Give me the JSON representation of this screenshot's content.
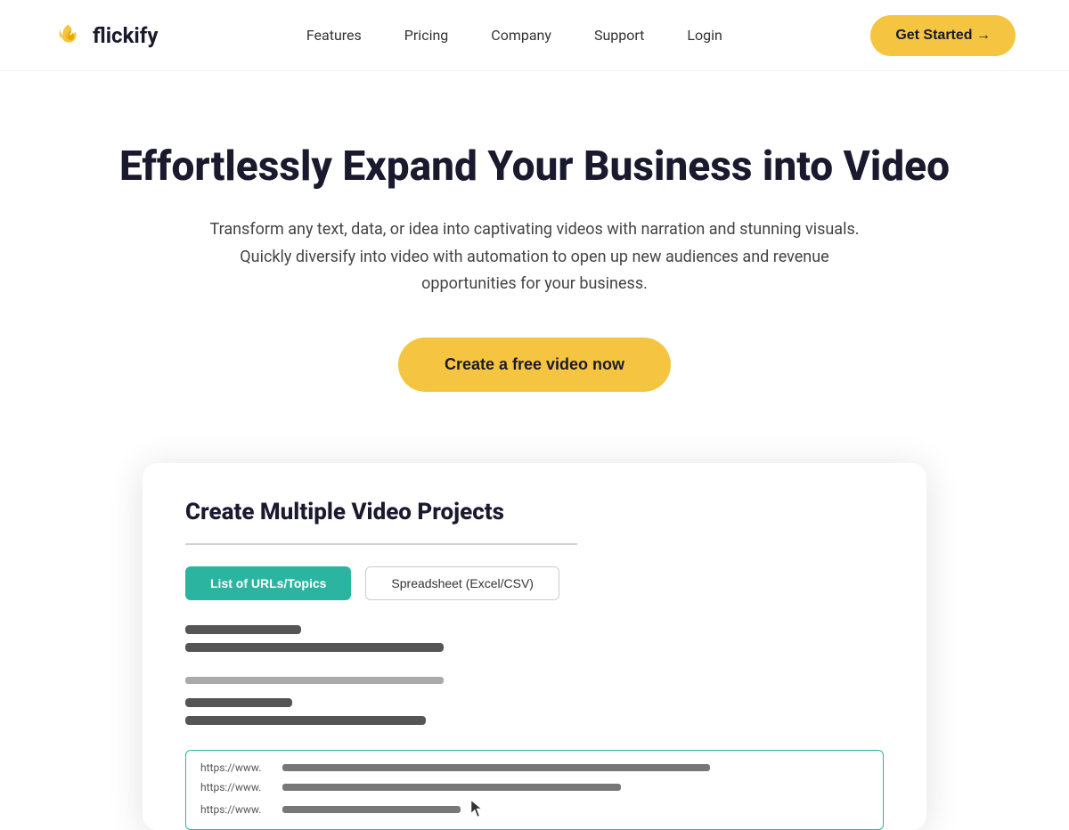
{
  "navbar": {
    "logo_text": "flickify",
    "nav_items": [
      {
        "label": "Features",
        "href": "#"
      },
      {
        "label": "Pricing",
        "href": "#"
      },
      {
        "label": "Company",
        "href": "#"
      },
      {
        "label": "Support",
        "href": "#"
      },
      {
        "label": "Login",
        "href": "#"
      }
    ],
    "cta_button": "Get Started →"
  },
  "hero": {
    "title": "Effortlessly Expand Your Business into Video",
    "subtitle": "Transform any text, data, or idea into captivating videos with narration and stunning visuals.  Quickly diversify into video with automation to open up new audiences and revenue opportunities for your business.",
    "cta_button": "Create a free video now"
  },
  "demo": {
    "title": "Create Multiple Video Projects",
    "tab_active": "List of URLs/Topics",
    "tab_inactive": "Spreadsheet (Excel/CSV)",
    "url_rows": [
      {
        "label": "https://www.",
        "bar_class": "demo-url-bar-long"
      },
      {
        "label": "https://www.",
        "bar_class": "demo-url-bar-medium"
      },
      {
        "label": "https://www.",
        "bar_class": "demo-url-bar-short"
      }
    ]
  },
  "colors": {
    "accent_yellow": "#f5c542",
    "accent_teal": "#2bb5a0",
    "text_dark": "#1a1a2e"
  }
}
